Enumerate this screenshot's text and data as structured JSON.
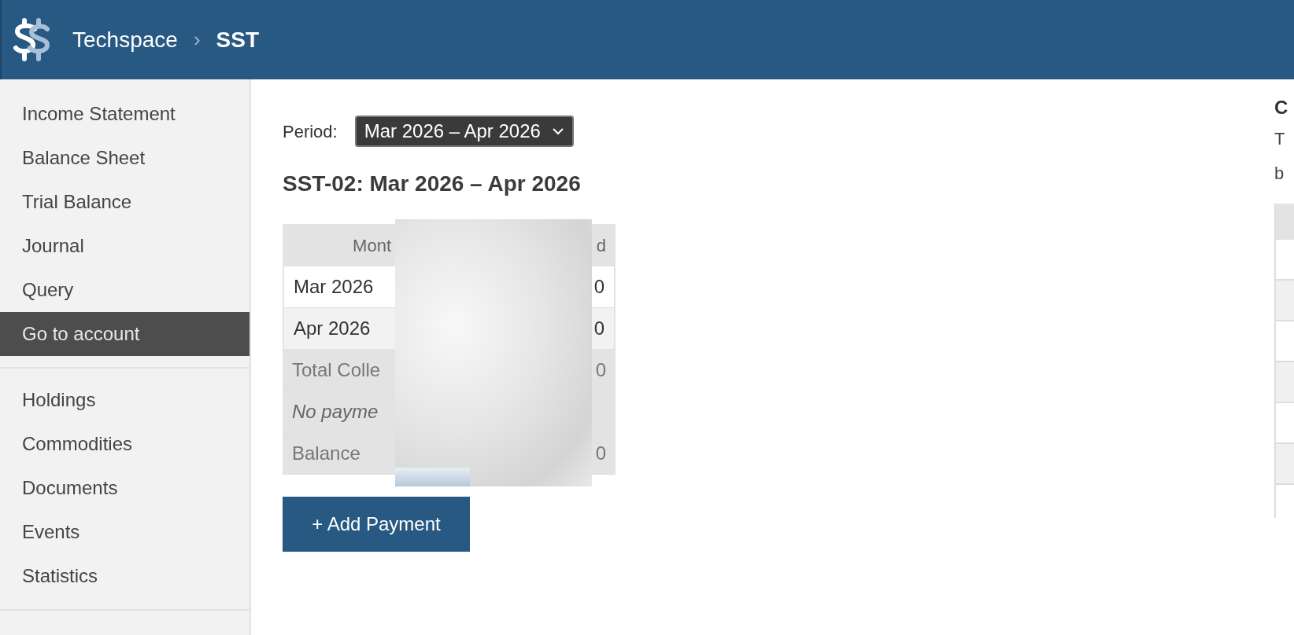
{
  "header": {
    "breadcrumbs": [
      {
        "label": "Techspace"
      },
      {
        "label": "SST"
      }
    ],
    "separator": "›"
  },
  "sidebar": {
    "groups": [
      {
        "items": [
          {
            "label": "Income Statement",
            "selected": false
          },
          {
            "label": "Balance Sheet",
            "selected": false
          },
          {
            "label": "Trial Balance",
            "selected": false
          },
          {
            "label": "Journal",
            "selected": false
          },
          {
            "label": "Query",
            "selected": false
          },
          {
            "label": "Go to account",
            "selected": true
          }
        ]
      },
      {
        "items": [
          {
            "label": "Holdings",
            "selected": false
          },
          {
            "label": "Commodities",
            "selected": false
          },
          {
            "label": "Documents",
            "selected": false
          },
          {
            "label": "Events",
            "selected": false
          },
          {
            "label": "Statistics",
            "selected": false
          }
        ]
      }
    ]
  },
  "period": {
    "label": "Period:",
    "value": "Mar 2026 – Apr 2026"
  },
  "title": "SST-02: Mar 2026 – Apr 2026",
  "table": {
    "header": [
      "Mont",
      "d"
    ],
    "rows": [
      {
        "kind": "month",
        "cells": [
          "Mar 2026",
          "0"
        ]
      },
      {
        "kind": "month",
        "cells": [
          "Apr 2026",
          "0"
        ]
      },
      {
        "kind": "total",
        "cells": [
          "Total Colle",
          "0"
        ]
      },
      {
        "kind": "note",
        "cells": [
          "No payme",
          ""
        ]
      },
      {
        "kind": "total",
        "cells": [
          "Balance",
          "0"
        ]
      }
    ]
  },
  "add_button": "+ Add Payment",
  "right_panel": {
    "heading": "C",
    "lines": [
      "T",
      "b"
    ]
  }
}
